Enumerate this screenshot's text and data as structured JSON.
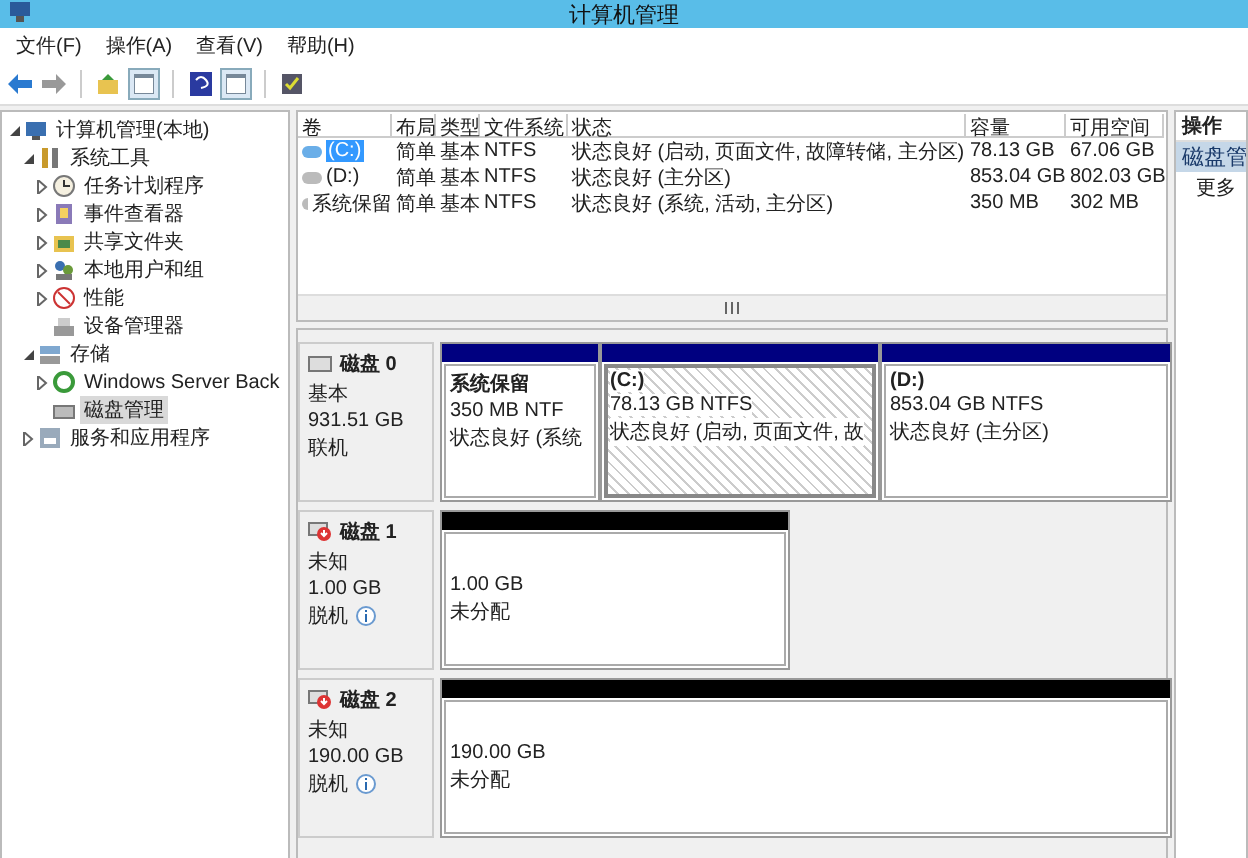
{
  "window": {
    "title": "计算机管理"
  },
  "menu": [
    "文件(F)",
    "操作(A)",
    "查看(V)",
    "帮助(H)"
  ],
  "tree": [
    {
      "label": "计算机管理(本地)",
      "expanded": true,
      "selected": false,
      "children": [
        {
          "label": "系统工具",
          "expanded": true,
          "selected": false,
          "children": [
            {
              "label": "任务计划程序",
              "expanded": false,
              "selected": false
            },
            {
              "label": "事件查看器",
              "expanded": false,
              "selected": false
            },
            {
              "label": "共享文件夹",
              "expanded": false,
              "selected": false
            },
            {
              "label": "本地用户和组",
              "expanded": false,
              "selected": false
            },
            {
              "label": "性能",
              "expanded": false,
              "selected": false
            },
            {
              "label": "设备管理器",
              "selected": false
            }
          ]
        },
        {
          "label": "存储",
          "expanded": true,
          "selected": false,
          "children": [
            {
              "label": "Windows Server Back",
              "expanded": false,
              "selected": false
            },
            {
              "label": "磁盘管理",
              "selected": true
            }
          ]
        },
        {
          "label": "服务和应用程序",
          "expanded": false,
          "selected": false
        }
      ]
    }
  ],
  "volumes": {
    "columns": [
      "卷",
      "布局",
      "类型",
      "文件系统",
      "状态",
      "容量",
      "可用空间"
    ],
    "rows": [
      {
        "cells": [
          "(C:)",
          "简单",
          "基本",
          "NTFS",
          "状态良好 (启动, 页面文件, 故障转储, 主分区)",
          "78.13 GB",
          "67.06 GB"
        ],
        "selected": true
      },
      {
        "cells": [
          "(D:)",
          "简单",
          "基本",
          "NTFS",
          "状态良好 (主分区)",
          "853.04 GB",
          "802.03 GB"
        ],
        "selected": false
      },
      {
        "cells": [
          "系统保留",
          "简单",
          "基本",
          "NTFS",
          "状态良好 (系统, 活动, 主分区)",
          "350 MB",
          "302 MB"
        ],
        "selected": false
      }
    ]
  },
  "disks": [
    {
      "name": "磁盘 0",
      "type": "基本",
      "size": "931.51 GB",
      "status": "联机",
      "online": true,
      "partitions": [
        {
          "kind": "primary",
          "name": "系统保留",
          "size": "350 MB NTF",
          "status": "状态良好 (系统",
          "selected": false
        },
        {
          "kind": "primary",
          "name": "(C:)",
          "size": "78.13 GB NTFS",
          "status": "状态良好 (启动, 页面文件, 故",
          "selected": true
        },
        {
          "kind": "primary",
          "name": "(D:)",
          "size": "853.04 GB NTFS",
          "status": "状态良好 (主分区)",
          "selected": false
        }
      ]
    },
    {
      "name": "磁盘 1",
      "type": "未知",
      "size": "1.00 GB",
      "status": "脱机",
      "online": false,
      "partitions": [
        {
          "kind": "unallocated",
          "size": "1.00 GB",
          "status": "未分配",
          "selected": false
        }
      ]
    },
    {
      "name": "磁盘 2",
      "type": "未知",
      "size": "190.00 GB",
      "status": "脱机",
      "online": false,
      "partitions": [
        {
          "kind": "unallocated",
          "size": "190.00 GB",
          "status": "未分配",
          "selected": false
        }
      ]
    }
  ],
  "actions": {
    "title": "操作",
    "items": [
      {
        "label": "磁盘管",
        "kind": "header"
      },
      {
        "label": "更多",
        "kind": "item"
      }
    ]
  }
}
